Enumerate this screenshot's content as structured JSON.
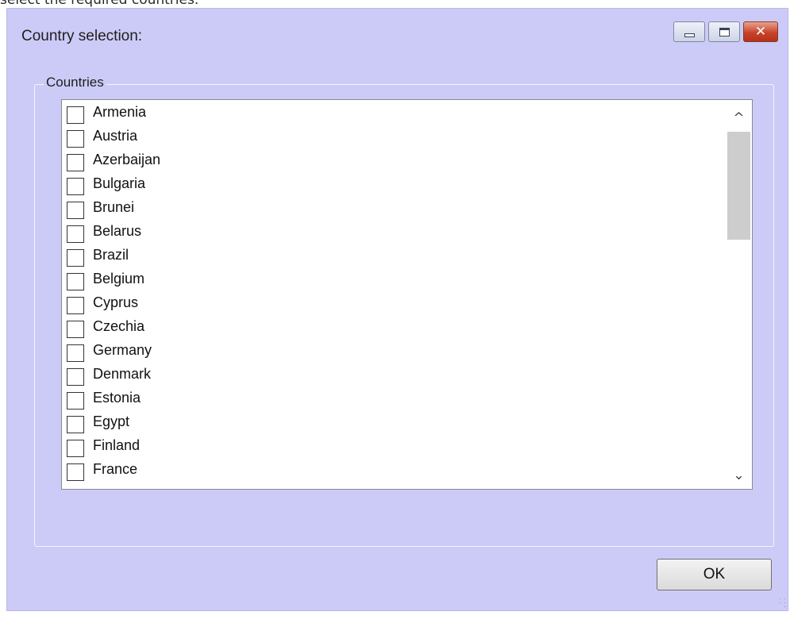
{
  "caption": "select the required countries.",
  "window": {
    "title": "Country selection:",
    "close_symbol": "✕"
  },
  "group": {
    "label": "Countries"
  },
  "countries": [
    {
      "label": "Armenia",
      "checked": false
    },
    {
      "label": "Austria",
      "checked": false
    },
    {
      "label": "Azerbaijan",
      "checked": false
    },
    {
      "label": "Bulgaria",
      "checked": false
    },
    {
      "label": "Brunei",
      "checked": false
    },
    {
      "label": "Belarus",
      "checked": false
    },
    {
      "label": "Brazil",
      "checked": false
    },
    {
      "label": "Belgium",
      "checked": false
    },
    {
      "label": "Cyprus",
      "checked": false
    },
    {
      "label": "Czechia",
      "checked": false
    },
    {
      "label": "Germany",
      "checked": false
    },
    {
      "label": "Denmark",
      "checked": false
    },
    {
      "label": "Estonia",
      "checked": false
    },
    {
      "label": "Egypt",
      "checked": false
    },
    {
      "label": "Finland",
      "checked": false
    },
    {
      "label": "France",
      "checked": false
    }
  ],
  "scrollbar": {
    "up_symbol": "^",
    "down_symbol": "⌄"
  },
  "buttons": {
    "ok_label": "OK"
  },
  "colors": {
    "window_background": "#cccbf7",
    "close_button": "#c6442b",
    "list_background": "#ffffff"
  }
}
